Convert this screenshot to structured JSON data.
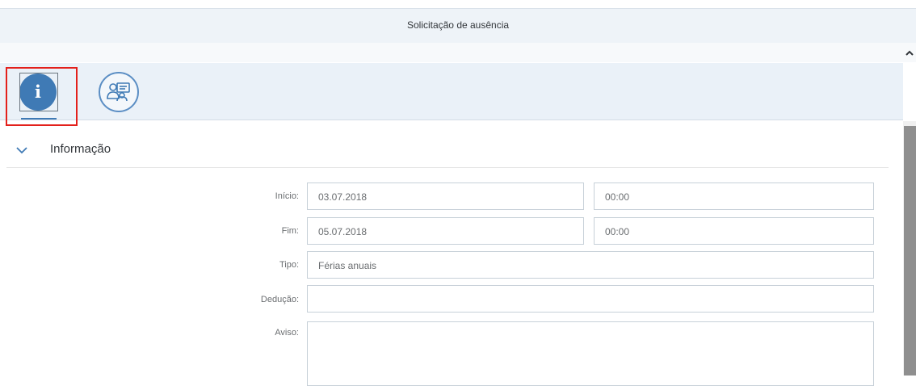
{
  "header": {
    "title": "Solicitação de ausência"
  },
  "tabs": [
    {
      "icon": "info-icon",
      "glyph": "i",
      "selected": true
    },
    {
      "icon": "people-icon",
      "selected": false
    }
  ],
  "section": {
    "title": "Informação",
    "expanded": true
  },
  "form": {
    "inicio_label": "Início:",
    "inicio_date": "03.07.2018",
    "inicio_time": "00:00",
    "fim_label": "Fim:",
    "fim_date": "05.07.2018",
    "fim_time": "00:00",
    "tipo_label": "Tipo:",
    "tipo_value": "Férias anuais",
    "deducao_label": "Dedução:",
    "deducao_value": "",
    "aviso_label": "Aviso:",
    "aviso_value": ""
  },
  "colors": {
    "accent": "#3f7ab5",
    "highlight": "#e3201b",
    "header_bg": "#eef3f8"
  }
}
